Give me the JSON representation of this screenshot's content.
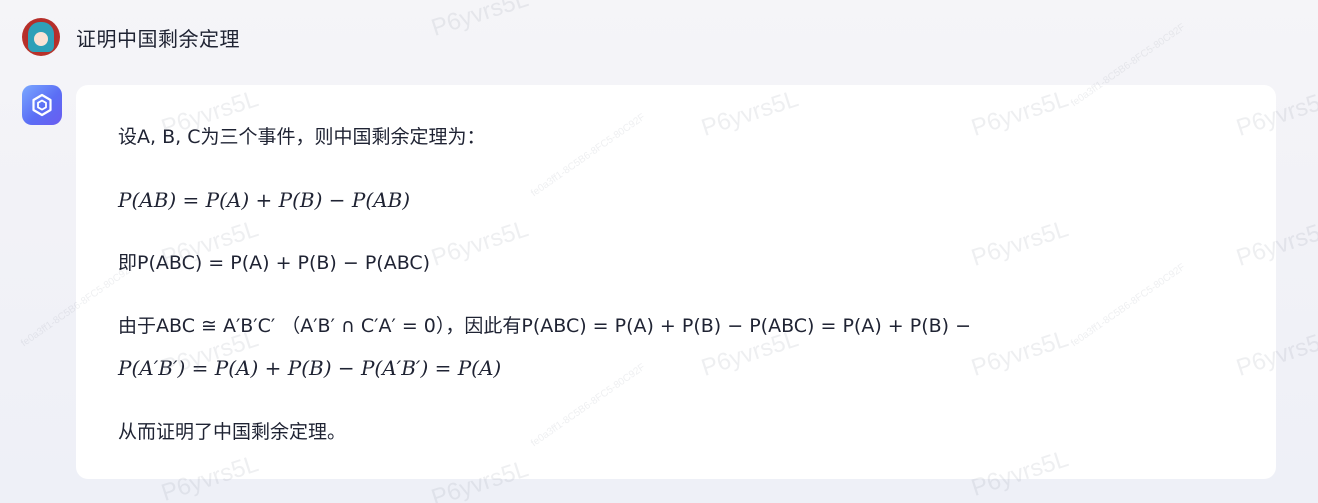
{
  "user": {
    "avatar_icon": "anime-avatar-icon",
    "question": "证明中国剩余定理"
  },
  "assistant": {
    "icon": "assistant-logo-icon",
    "paragraphs": {
      "p1": "设A, B, C为三个事件，则中国剩余定理为：",
      "p2": "P(AB) = P(A) + P(B) − P(AB)",
      "p3": "即P(ABC) = P(A) + P(B) − P(ABC)",
      "p4a": "由于ABC ≅ A′B′C′ （A′B′ ∩ C′A′ = 0），因此有P(ABC) = P(A) + P(B) − P(ABC) = P(A) + P(B) −",
      "p4b": "P(A′B′) = P(A) + P(B) − P(A′B′) = P(A)",
      "p5": "从而证明了中国剩余定理。"
    }
  },
  "watermark": {
    "text": "P6yvrs5L",
    "small_text": "fe0a3ff1-8C5B6-8FC5-80C92F"
  },
  "colors": {
    "assistant_icon_gradient_start": "#7aa8ff",
    "assistant_icon_gradient_end": "#6a5cf0",
    "card_background": "#ffffff",
    "text": "#1f2333"
  }
}
